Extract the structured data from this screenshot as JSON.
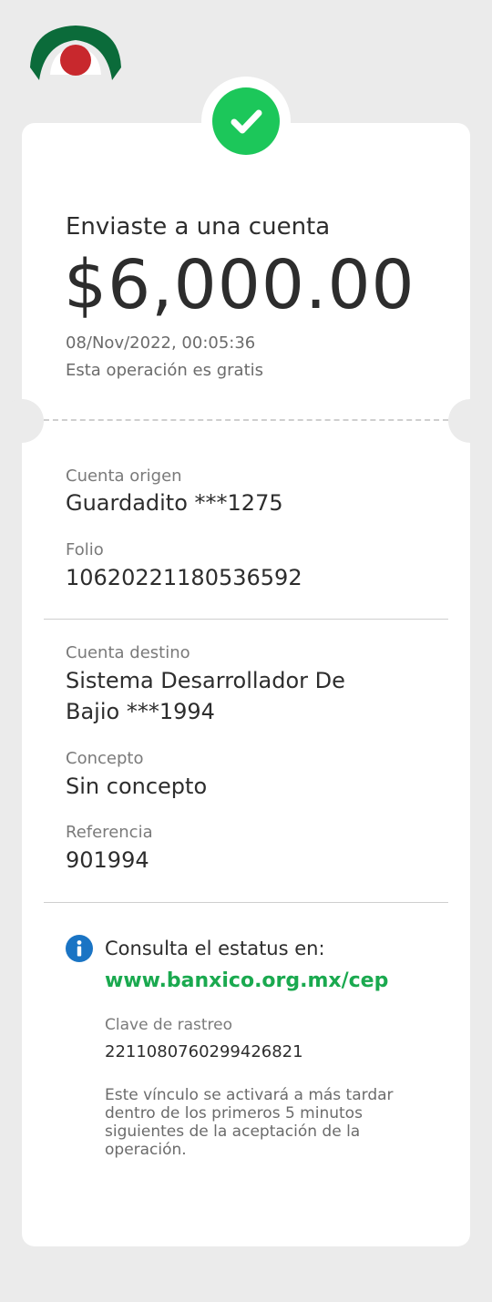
{
  "brand": {
    "logo_icon": "bank-logo-icon",
    "colors": {
      "green": "#0b6b3a",
      "red": "#c8282d",
      "success": "#1cc75a",
      "link": "#1aa94f",
      "info": "#1a74c4"
    }
  },
  "status": {
    "icon": "check-icon"
  },
  "transfer": {
    "title": "Enviaste a una cuenta",
    "amount": "$6,000.00",
    "datetime": "08/Nov/2022, 00:05:36",
    "fee_note": "Esta operación es gratis"
  },
  "origin": {
    "account_label": "Cuenta origen",
    "account_value": "Guardadito ***1275",
    "folio_label": "Folio",
    "folio_value": "10620221180536592"
  },
  "destination": {
    "account_label": "Cuenta destino",
    "account_value_line1": "Sistema Desarrollador De",
    "account_value_line2": "Bajio ***1994",
    "concept_label": "Concepto",
    "concept_value": "Sin concepto",
    "reference_label": "Referencia",
    "reference_value": "901994"
  },
  "status_info": {
    "icon": "info-icon",
    "text": "Consulta el estatus en:",
    "link": "www.banxico.org.mx/cep",
    "tracking_label": "Clave de rastreo",
    "tracking_value": "2211080760299426821",
    "note": "Este vínculo se activará a más tardar dentro de los primeros 5 minutos siguientes de la aceptación de la operación."
  }
}
